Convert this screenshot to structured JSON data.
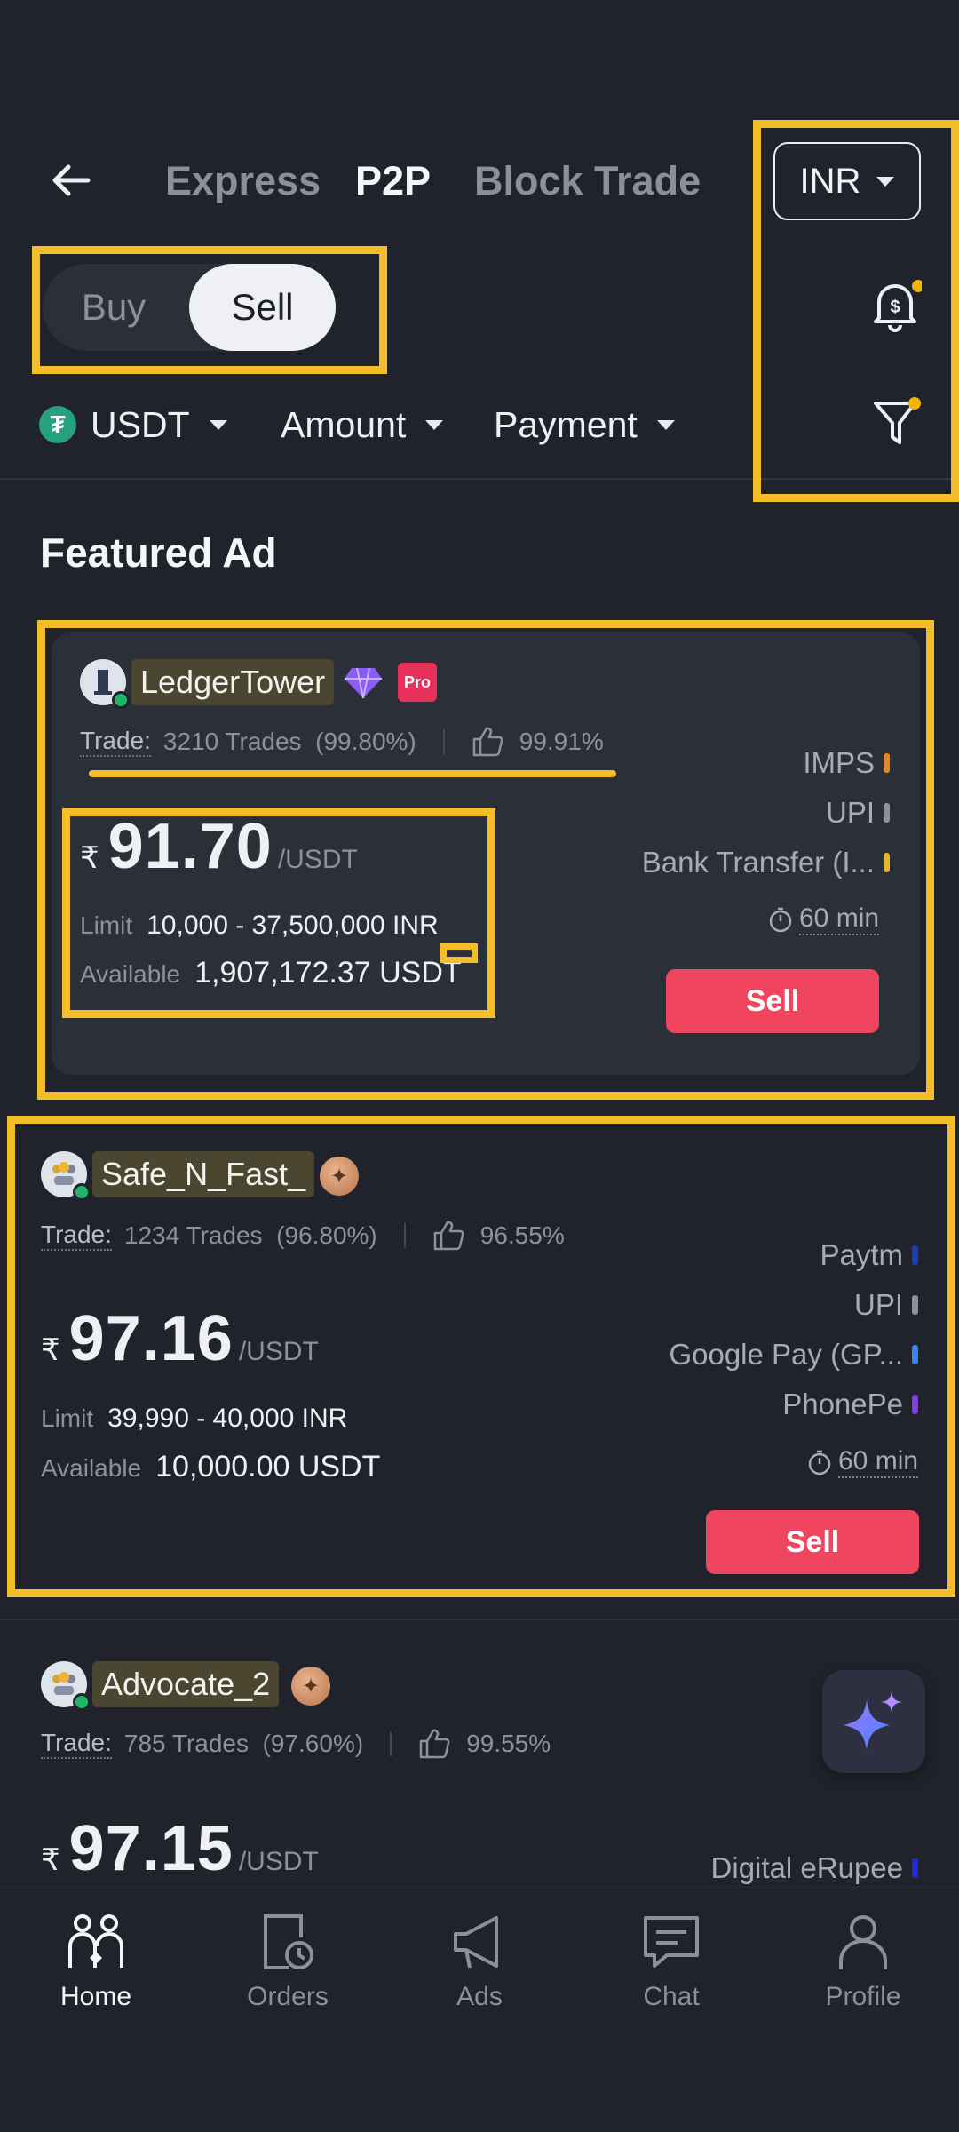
{
  "header": {
    "tabs": [
      {
        "label": "Express"
      },
      {
        "label": "P2P"
      },
      {
        "label": "Block Trade"
      }
    ],
    "currency": "INR"
  },
  "side_toggle": {
    "buy_label": "Buy",
    "sell_label": "Sell"
  },
  "filters": {
    "asset": "USDT",
    "amount_label": "Amount",
    "payment_label": "Payment"
  },
  "section_title": "Featured Ad",
  "ads": [
    {
      "username": "LedgerTower",
      "trade_label": "Trade:",
      "trades": "3210 Trades",
      "completion": "(99.80%)",
      "rating": "99.91%",
      "currency_symbol": "₹",
      "price": "91.70",
      "unit": "/USDT",
      "limit_label": "Limit",
      "limit": "10,000 - 37,500,000 INR",
      "available_label": "Available",
      "available": "1,907,172.37 USDT",
      "payments": [
        {
          "name": "IMPS",
          "color": "#e8822c"
        },
        {
          "name": "UPI",
          "color": "#8c919c"
        },
        {
          "name": "Bank Transfer (I...",
          "color": "#e7b52c"
        }
      ],
      "time": "60 min",
      "action": "Sell"
    },
    {
      "username": "Safe_N_Fast_",
      "trade_label": "Trade:",
      "trades": "1234 Trades",
      "completion": "(96.80%)",
      "rating": "96.55%",
      "currency_symbol": "₹",
      "price": "97.16",
      "unit": "/USDT",
      "limit_label": "Limit",
      "limit": "39,990 - 40,000 INR",
      "available_label": "Available",
      "available": "10,000.00 USDT",
      "payments": [
        {
          "name": "Paytm",
          "color": "#1b3fb0"
        },
        {
          "name": "UPI",
          "color": "#8c919c"
        },
        {
          "name": "Google Pay (GP...",
          "color": "#3b82f6"
        },
        {
          "name": "PhonePe",
          "color": "#7b3fe4"
        }
      ],
      "time": "60 min",
      "action": "Sell"
    },
    {
      "username": "Advocate_2",
      "trade_label": "Trade:",
      "trades": "785 Trades",
      "completion": "(97.60%)",
      "rating": "99.55%",
      "currency_symbol": "₹",
      "price": "97.15",
      "unit": "/USDT",
      "payments": [
        {
          "name": "Digital eRupee",
          "color": "#1c2bd6"
        }
      ]
    }
  ],
  "nav": [
    {
      "label": "Home",
      "icon": "home-icon"
    },
    {
      "label": "Orders",
      "icon": "orders-icon"
    },
    {
      "label": "Ads",
      "icon": "ads-icon"
    },
    {
      "label": "Chat",
      "icon": "chat-icon"
    },
    {
      "label": "Profile",
      "icon": "profile-icon"
    }
  ],
  "colors": {
    "accent": "#f0455f",
    "highlight": "#f3bd2b",
    "background": "#20232c"
  }
}
